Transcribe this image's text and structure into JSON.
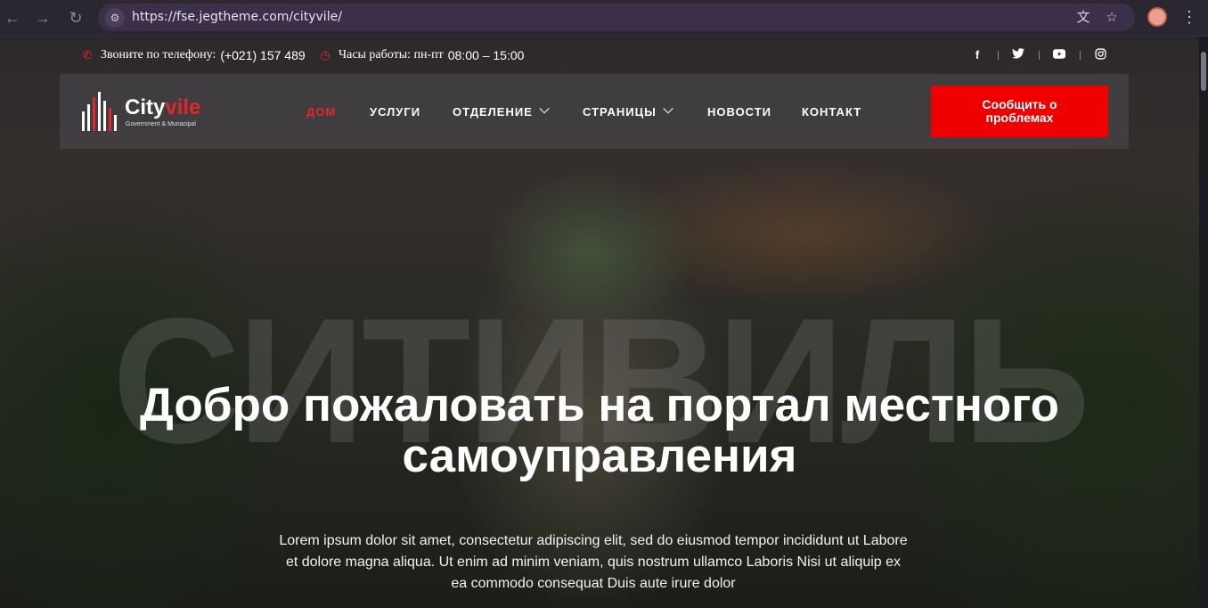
{
  "browser": {
    "url": "https://fse.jegtheme.com/cityvile/",
    "icons": [
      "back-icon",
      "forward-icon",
      "reload-icon",
      "site-info-icon",
      "translate-icon",
      "star-icon",
      "profile-avatar",
      "menu-icon"
    ]
  },
  "topbar": {
    "phone_label": "Звоните по телефону:",
    "phone_value": "(+021) 157 489",
    "hours_label": "Часы работы: пн-пт",
    "hours_value": "08:00 – 15:00",
    "social": {
      "facebook": "f",
      "twitter": "t",
      "youtube": "▶",
      "instagram": "◎"
    }
  },
  "logo": {
    "name_main": "City",
    "name_accent": "vile",
    "subtitle": "Government & Munacipal"
  },
  "nav": {
    "items": [
      {
        "label": "ДОМ",
        "active": true
      },
      {
        "label": "УСЛУГИ"
      },
      {
        "label": "ОТДЕЛЕНИЕ",
        "dropdown": true
      },
      {
        "label": "СТРАНИЦЫ",
        "dropdown": true
      },
      {
        "label": "НОВОСТИ"
      },
      {
        "label": "КОНТАКТ"
      }
    ],
    "cta": "Сообщить о проблемах"
  },
  "hero": {
    "watermark": "СИТИВИЛЬ",
    "title_line1": "Добро пожаловать на портал местного",
    "title_line2": "самоуправления",
    "text_line1": "Lorem ipsum dolor sit amet, consectetur adipiscing elit, sed do eiusmod tempor incididunt ut Labore",
    "text_line2": "et dolore magna aliqua. Ut enim ad minim veniam, quis nostrum ullamco Laboris Nisi ut aliquip ex",
    "text_line3": "ea commodo consequat Duis aute irure dolor"
  },
  "colors": {
    "accent": "#e3262b",
    "cta_bg": "#ee0000",
    "active_nav": "#e3262b"
  }
}
